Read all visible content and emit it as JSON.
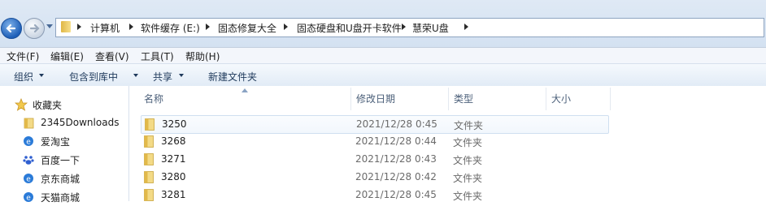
{
  "address": {
    "crumbs": [
      "计算机",
      "软件缓存 (E:)",
      "固态修复大全",
      "固态硬盘和U盘开卡软件",
      "慧荣U盘"
    ]
  },
  "menu": [
    "文件(F)",
    "编辑(E)",
    "查看(V)",
    "工具(T)",
    "帮助(H)"
  ],
  "commands": {
    "organize": "组织",
    "include_in_library": "包含到库中",
    "share": "共享",
    "new_folder": "新建文件夹"
  },
  "nav": {
    "items": [
      {
        "label": "收藏夹",
        "icon": "star-icon"
      },
      {
        "label": "2345Downloads",
        "icon": "folder-icon"
      },
      {
        "label": "爱淘宝",
        "icon": "ie-link-icon"
      },
      {
        "label": "百度一下",
        "icon": "baidu-icon"
      },
      {
        "label": "京东商城",
        "icon": "ie-link-icon"
      },
      {
        "label": "天猫商城",
        "icon": "ie-link-icon"
      }
    ]
  },
  "columns": {
    "name": "名称",
    "modified": "修改日期",
    "type": "类型",
    "size": "大小"
  },
  "files": [
    {
      "name": "3250",
      "modified": "2021/12/28 0:45",
      "type": "文件夹"
    },
    {
      "name": "3268",
      "modified": "2021/12/28 0:44",
      "type": "文件夹"
    },
    {
      "name": "3271",
      "modified": "2021/12/28 0:43",
      "type": "文件夹"
    },
    {
      "name": "3280",
      "modified": "2021/12/28 0:42",
      "type": "文件夹"
    },
    {
      "name": "3281",
      "modified": "2021/12/28 0:45",
      "type": "文件夹"
    }
  ],
  "colors": {
    "accent": "#1e5fb8",
    "folder": "#e8c45a",
    "selection": "#cfdff0"
  }
}
